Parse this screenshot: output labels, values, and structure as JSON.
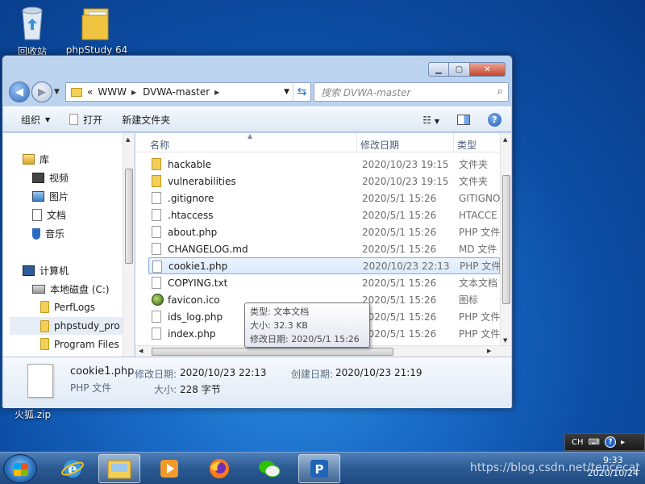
{
  "desktop": {
    "icons": [
      {
        "label": "回收站",
        "icon": "recycle-bin-icon"
      },
      {
        "label": "phpStudy 64",
        "icon": "folder-icon"
      },
      {
        "label": "火狐.zip",
        "icon": "zip-icon"
      }
    ]
  },
  "window": {
    "controls": {
      "minimize": "▁",
      "maximize": "▢",
      "close": "✕"
    },
    "address": {
      "prefix": "«",
      "segments": [
        "WWW",
        "DVWA-master"
      ]
    },
    "search": {
      "placeholder": "搜索 DVWA-master"
    },
    "commands": {
      "organize": "组织",
      "open": "打开",
      "new_folder": "新建文件夹"
    },
    "nav_pane": {
      "libraries": "库",
      "videos": "视频",
      "pictures": "图片",
      "documents": "文档",
      "music": "音乐",
      "computer": "计算机",
      "local_disk": "本地磁盘 (C:)",
      "perflogs": "PerfLogs",
      "phpstudy": "phpstudy_pro",
      "program_files": "Program Files"
    },
    "columns": {
      "name": "名称",
      "date": "修改日期",
      "type": "类型"
    },
    "files": [
      {
        "name": "hackable",
        "date": "2020/10/23 19:15",
        "type": "文件夹",
        "icon": "folder"
      },
      {
        "name": "vulnerabilities",
        "date": "2020/10/23 19:15",
        "type": "文件夹",
        "icon": "folder"
      },
      {
        "name": ".gitignore",
        "date": "2020/5/1 15:26",
        "type": "GITIGNO",
        "icon": "file"
      },
      {
        "name": ".htaccess",
        "date": "2020/5/1 15:26",
        "type": "HTACCE",
        "icon": "file"
      },
      {
        "name": "about.php",
        "date": "2020/5/1 15:26",
        "type": "PHP 文件",
        "icon": "file"
      },
      {
        "name": "CHANGELOG.md",
        "date": "2020/5/1 15:26",
        "type": "MD 文件",
        "icon": "file"
      },
      {
        "name": "cookie1.php",
        "date": "2020/10/23 22:13",
        "type": "PHP 文件",
        "icon": "file"
      },
      {
        "name": "COPYING.txt",
        "date": "2020/5/1 15:26",
        "type": "文本文档",
        "icon": "file"
      },
      {
        "name": "favicon.ico",
        "date": "2020/5/1 15:26",
        "type": "图标",
        "icon": "favicon"
      },
      {
        "name": "ids_log.php",
        "date": "2020/5/1 15:26",
        "type": "PHP 文件",
        "icon": "file"
      },
      {
        "name": "index.php",
        "date": "2020/5/1 15:26",
        "type": "PHP 文件",
        "icon": "file"
      }
    ],
    "tooltip": {
      "type": "类型: 文本文档",
      "size": "大小: 32.3 KB",
      "modified": "修改日期: 2020/5/1 15:26"
    },
    "details": {
      "name": "cookie1.php",
      "type": "PHP 文件",
      "modified_label": "修改日期:",
      "modified_value": "2020/10/23 22:13",
      "created_label": "创建日期:",
      "created_value": "2020/10/23 21:19",
      "size_label": "大小:",
      "size_value": "228 字节"
    }
  },
  "taskbar": {
    "apps": [
      "internet-explorer-icon",
      "file-explorer-icon",
      "media-player-icon",
      "firefox-icon",
      "wechat-icon",
      "phpstudy-icon"
    ],
    "tray": {
      "lang": "CH",
      "help": "?"
    },
    "clock": {
      "time": "9:33",
      "date": "2020/10/24"
    },
    "watermark": "https://blog.csdn.net/tencecat"
  }
}
